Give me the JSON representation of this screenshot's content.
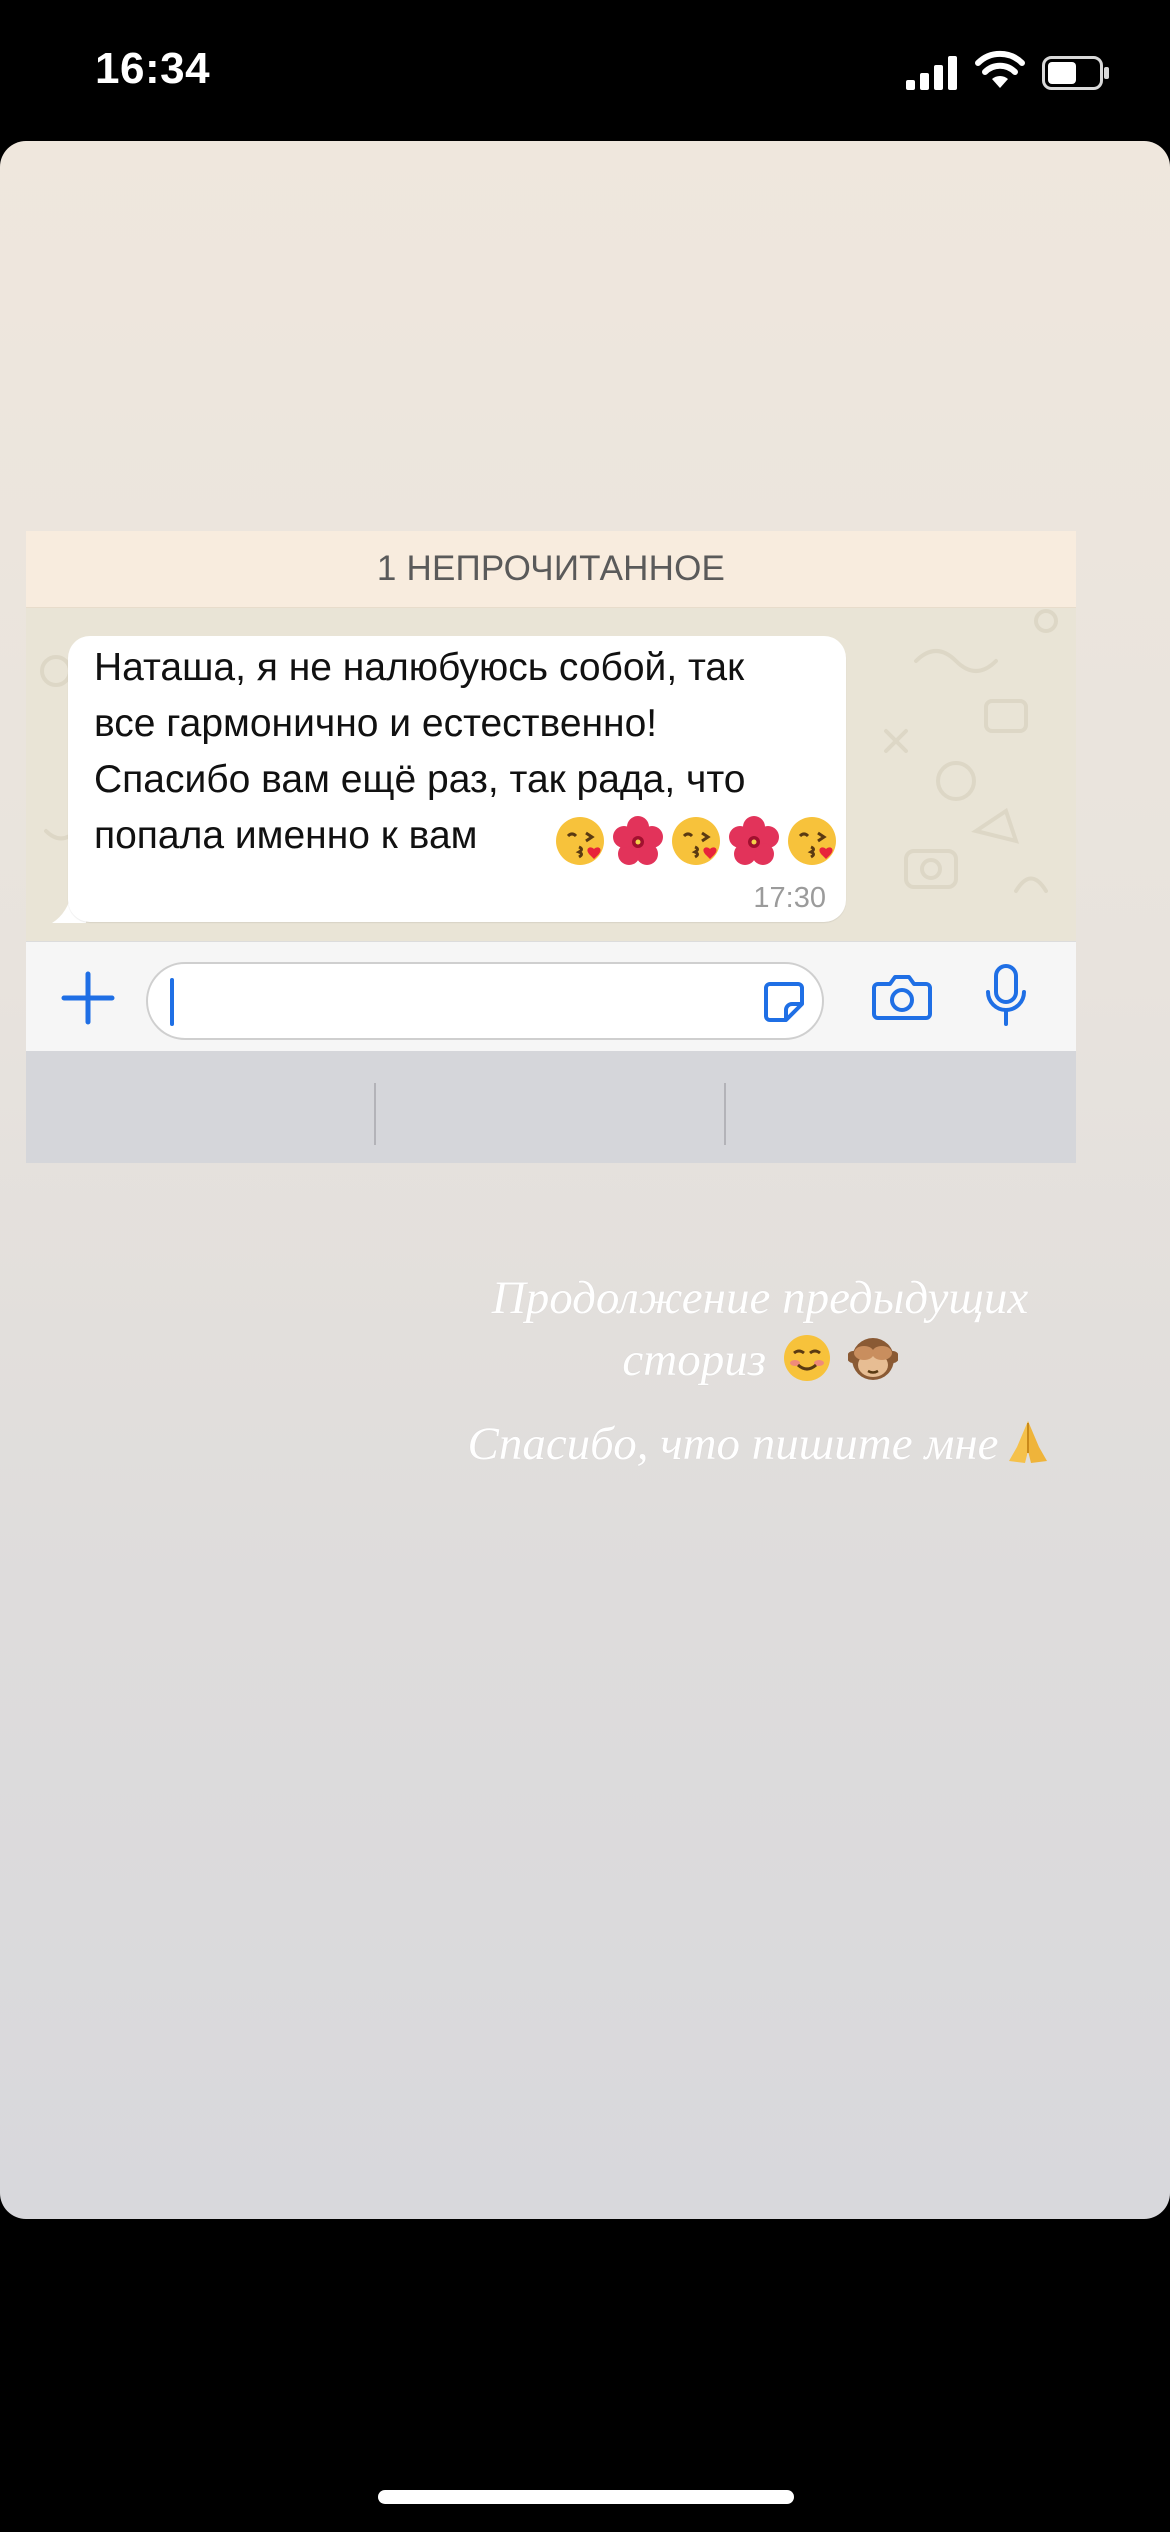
{
  "status_bar": {
    "time": "16:34"
  },
  "chat": {
    "unread_banner": "1 НЕПРОЧИТАННОЕ",
    "message": {
      "lines": [
        "Наташа, я не налюбуюсь собой, так",
        "все гармонично и естественно!",
        "Спасибо вам ещё раз, так рада, что",
        "попала именно к вам"
      ],
      "emojis": [
        "kissing-face",
        "hibiscus",
        "kissing-face",
        "hibiscus",
        "kissing-face"
      ],
      "time": "17:30"
    },
    "input": {
      "placeholder": ""
    }
  },
  "captions": {
    "line1": "Продолжение предыдущих",
    "line2": "сториз",
    "line2_emojis": [
      "smiling-face",
      "see-no-evil-monkey"
    ],
    "line3": "Спасибо, что пишите мне",
    "line3_emojis": [
      "folded-hands"
    ]
  },
  "colors": {
    "accent_blue": "#1f6fe5",
    "bubble": "#ffffff",
    "banner": "#f8ecde"
  }
}
